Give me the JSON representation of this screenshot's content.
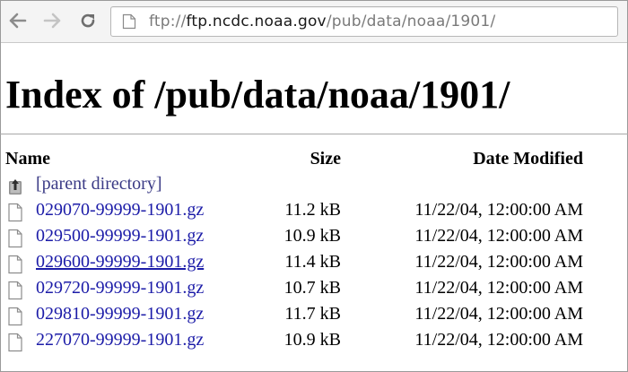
{
  "browser": {
    "url_scheme": "ftp://",
    "url_host": "ftp.ncdc.noaa.gov",
    "url_path": "/pub/data/noaa/1901/"
  },
  "page": {
    "heading": "Index of /pub/data/noaa/1901/",
    "columns": {
      "name": "Name",
      "size": "Size",
      "date": "Date Modified"
    },
    "parent_link": "[parent directory]",
    "files": [
      {
        "name": "029070-99999-1901.gz",
        "size": "11.2 kB",
        "date": "11/22/04, 12:00:00 AM"
      },
      {
        "name": "029500-99999-1901.gz",
        "size": "10.9 kB",
        "date": "11/22/04, 12:00:00 AM"
      },
      {
        "name": "029600-99999-1901.gz",
        "size": "11.4 kB",
        "date": "11/22/04, 12:00:00 AM"
      },
      {
        "name": "029720-99999-1901.gz",
        "size": "10.7 kB",
        "date": "11/22/04, 12:00:00 AM"
      },
      {
        "name": "029810-99999-1901.gz",
        "size": "11.7 kB",
        "date": "11/22/04, 12:00:00 AM"
      },
      {
        "name": "227070-99999-1901.gz",
        "size": "10.9 kB",
        "date": "11/22/04, 12:00:00 AM"
      }
    ]
  },
  "colors": {
    "link": "#1c1ca8",
    "hovered_row": 2
  }
}
